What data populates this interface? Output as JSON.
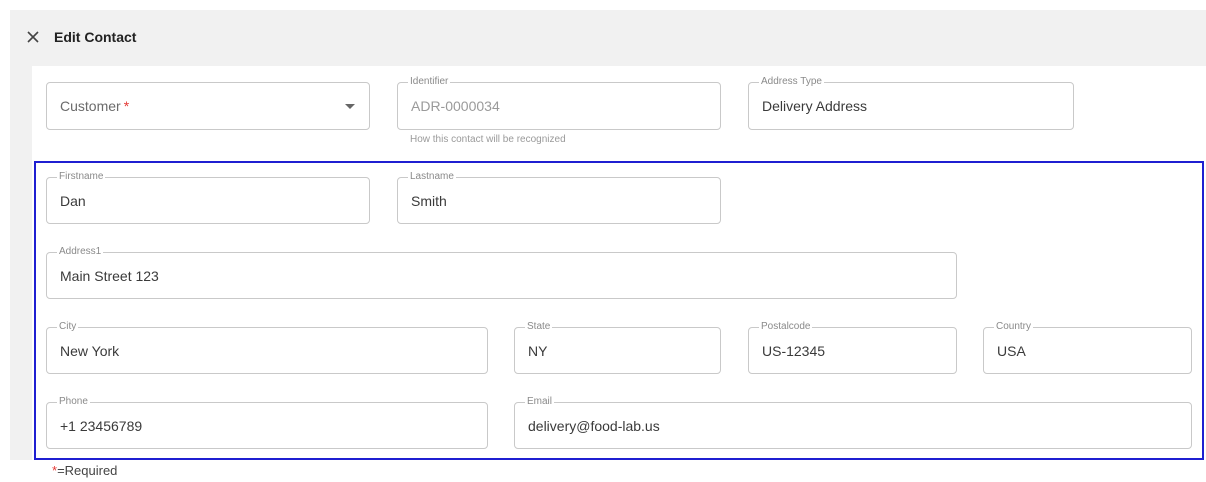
{
  "header": {
    "title": "Edit Contact",
    "close_icon": "close-icon"
  },
  "customer": {
    "placeholder": "Customer",
    "required_mark": "*"
  },
  "identifier": {
    "label": "Identifier",
    "value": "ADR-0000034",
    "helper": "How this contact will be recognized"
  },
  "address_type": {
    "label": "Address Type",
    "value": "Delivery Address"
  },
  "firstname": {
    "label": "Firstname",
    "value": "Dan"
  },
  "lastname": {
    "label": "Lastname",
    "value": "Smith"
  },
  "address1": {
    "label": "Address1",
    "value": "Main Street 123"
  },
  "city": {
    "label": "City",
    "value": "New York"
  },
  "state": {
    "label": "State",
    "value": "NY"
  },
  "postalcode": {
    "label": "Postalcode",
    "value": "US-12345"
  },
  "country": {
    "label": "Country",
    "value": "USA"
  },
  "phone": {
    "label": "Phone",
    "value": "+1 23456789"
  },
  "email": {
    "label": "Email",
    "value": "delivery@food-lab.us"
  },
  "footer": {
    "star": "*",
    "note": "=Required"
  },
  "colors": {
    "highlight": "#1f1fd1",
    "required": "#e53935",
    "header_bg": "#f1f1f1"
  }
}
